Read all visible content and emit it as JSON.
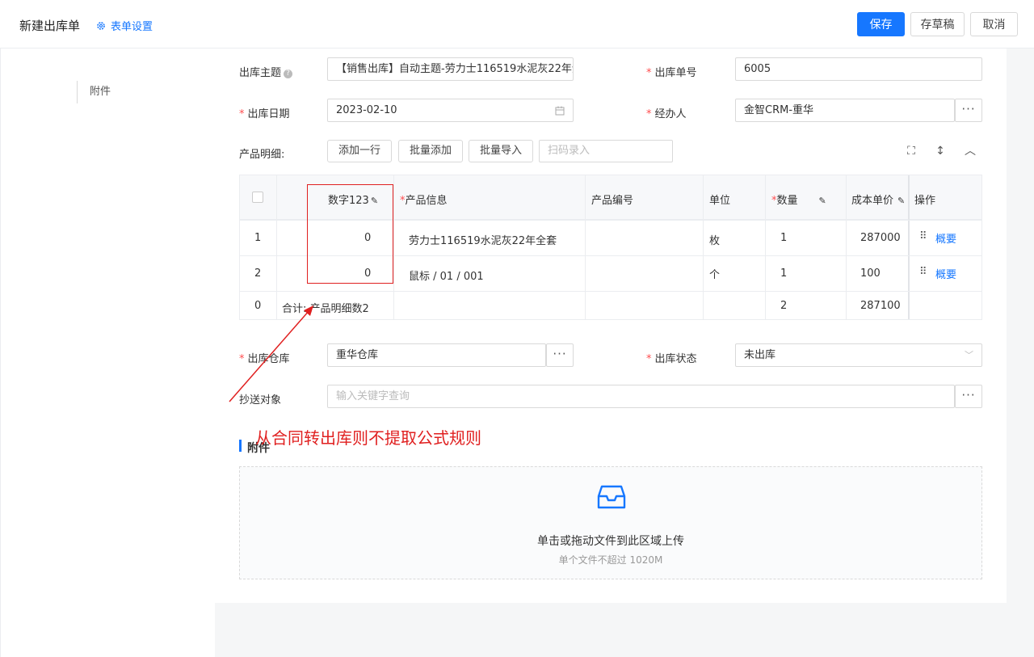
{
  "header": {
    "title": "新建出库单",
    "settings_label": "表单设置",
    "save_label": "保存",
    "draft_label": "存草稿",
    "cancel_label": "取消"
  },
  "sidebar": {
    "items": [
      {
        "label": "附件"
      }
    ]
  },
  "form": {
    "subject_label": "出库主题",
    "subject_value": "【销售出库】自动主题-劳力士116519水泥灰22年全",
    "order_no_label": "出库单号",
    "order_no_value": "6005",
    "date_label": "出库日期",
    "date_value": "2023-02-10",
    "handler_label": "经办人",
    "handler_value": "金智CRM-重华",
    "product_detail_label": "产品明细:",
    "add_row_label": "添加一行",
    "batch_add_label": "批量添加",
    "batch_import_label": "批量导入",
    "scan_placeholder": "扫码录入",
    "warehouse_label": "出库仓库",
    "warehouse_value": "重华仓库",
    "status_label": "出库状态",
    "status_value": "未出库",
    "cc_label": "抄送对象",
    "cc_placeholder": "输入关键字查询"
  },
  "table": {
    "columns": {
      "number": "数字123",
      "product_info": "产品信息",
      "product_code": "产品编号",
      "unit": "单位",
      "quantity": "数量",
      "cost_price": "成本单价",
      "action": "操作"
    },
    "rows": [
      {
        "index": "1",
        "number": "0",
        "product_info": "劳力士116519水泥灰22年全套",
        "product_code": "",
        "unit": "枚",
        "quantity": "1",
        "cost_price": "287000",
        "action": "概要"
      },
      {
        "index": "2",
        "number": "0",
        "product_info": "鼠标 / 01 / 001",
        "product_code": "",
        "unit": "个",
        "quantity": "1",
        "cost_price": "100",
        "action": "概要"
      }
    ],
    "total": {
      "index": "0",
      "label": "合计: 产品明细数2",
      "quantity": "2",
      "cost_price": "287100"
    }
  },
  "attachment": {
    "section_title": "附件",
    "upload_text": "单击或拖动文件到此区域上传",
    "upload_hint": "单个文件不超过 1020M"
  },
  "annotation": {
    "text": "从合同转出库则不提取公式规则"
  },
  "colors": {
    "primary": "#1677ff",
    "annotation": "#e02020",
    "required": "#ff4d4f"
  }
}
